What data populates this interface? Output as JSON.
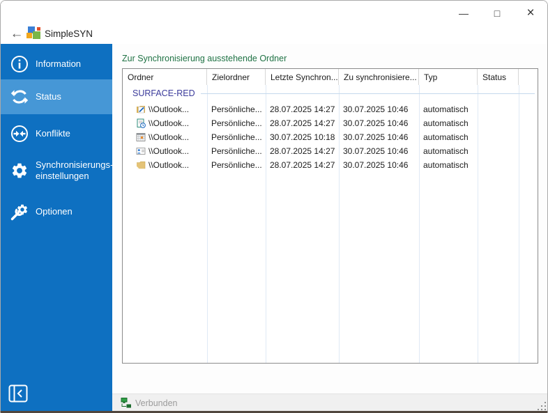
{
  "titlebar": {
    "app_name": "SimpleSYN",
    "back_icon": "←",
    "minimize_glyph": "—",
    "maximize_glyph": "□",
    "close_glyph": "×"
  },
  "sidebar": {
    "items": [
      {
        "label": "Information",
        "icon": "info-icon",
        "selected": false
      },
      {
        "label": "Status",
        "icon": "sync-icon",
        "selected": true
      },
      {
        "label": "Konflikte",
        "icon": "conflict-arrows-icon",
        "selected": false
      },
      {
        "label_line1": "Synchronisierungs-",
        "label_line2": "einstellungen",
        "icon": "gear-icon",
        "selected": false
      },
      {
        "label": "Optionen",
        "icon": "gear-wrench-icon",
        "selected": false
      }
    ],
    "collapse_button_icon": "collapse-panel-icon"
  },
  "main": {
    "heading": "Zur Synchronisierung ausstehende Ordner",
    "table": {
      "columns": [
        "Ordner",
        "Zielordner",
        "Letzte Synchron...",
        "Zu synchronisiere...",
        "Typ",
        "Status"
      ],
      "group_label": "SURFACE-RED",
      "rows": [
        {
          "icon": "journal-icon",
          "ordner": "\\\\Outlook...",
          "zielordner": "Persönliche...",
          "letzte": "28.07.2025 14:27",
          "zu": "30.07.2025 10:46",
          "typ": "automatisch",
          "status": ""
        },
        {
          "icon": "tasks-icon",
          "ordner": "\\\\Outlook...",
          "zielordner": "Persönliche...",
          "letzte": "28.07.2025 14:27",
          "zu": "30.07.2025 10:46",
          "typ": "automatisch",
          "status": ""
        },
        {
          "icon": "calendar-icon",
          "ordner": "\\\\Outlook...",
          "zielordner": "Persönliche...",
          "letzte": "30.07.2025 10:18",
          "zu": "30.07.2025 10:46",
          "typ": "automatisch",
          "status": ""
        },
        {
          "icon": "contacts-icon",
          "ordner": "\\\\Outlook...",
          "zielordner": "Persönliche...",
          "letzte": "28.07.2025 14:27",
          "zu": "30.07.2025 10:46",
          "typ": "automatisch",
          "status": ""
        },
        {
          "icon": "folder-icon",
          "ordner": "\\\\Outlook...",
          "zielordner": "Persönliche...",
          "letzte": "28.07.2025 14:27",
          "zu": "30.07.2025 10:46",
          "typ": "automatisch",
          "status": ""
        }
      ]
    }
  },
  "statusbar": {
    "text": "Verbunden",
    "icon": "network-connected-icon"
  },
  "colors": {
    "sidebar_blue": "#0e70c1",
    "sidebar_selected_blue": "#4697d6",
    "heading_green": "#1f7244",
    "group_navy": "#3b3b9b",
    "status_green": "#1b6b2d"
  }
}
